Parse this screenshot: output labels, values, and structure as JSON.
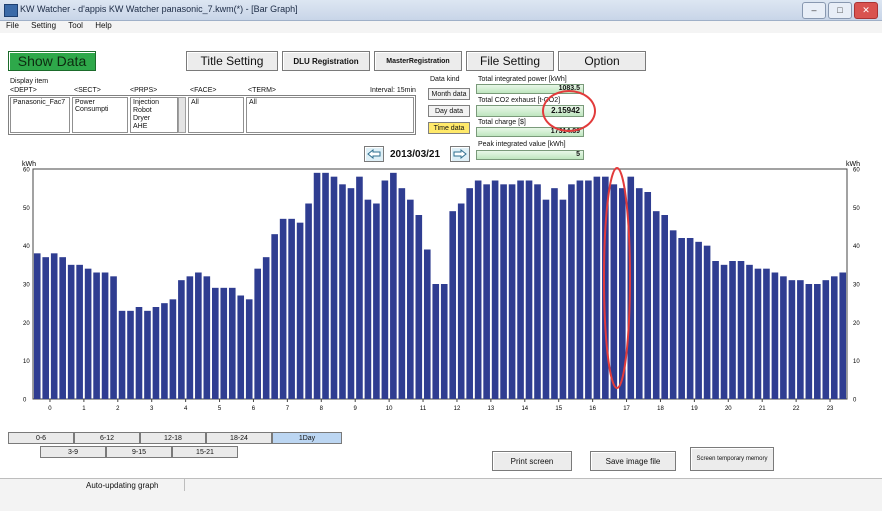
{
  "window": {
    "title": "KW Watcher - d'appis KW Watcher panasonic_7.kwm(*) - [Bar Graph]",
    "controls": [
      "–",
      "□",
      "✕"
    ]
  },
  "menu": [
    "File",
    "Setting",
    "Tool",
    "Help"
  ],
  "toolbar": {
    "show_data": "Show Data",
    "title_setting": "Title Setting",
    "dlu_registration": "DLU Registration",
    "master_registration": "MasterRegistration",
    "file_setting": "File Setting",
    "option": "Option"
  },
  "display_item": {
    "caption": "Display item",
    "dept_label": "<DEPT>",
    "sect_label": "<SECT>",
    "prps_label": "<PRPS>",
    "face_label": "<FACE>",
    "term_label": "<TERM>",
    "interval": "Interval: 15min",
    "dept_value": "Panasonic_Fac7",
    "sect_value": "Power Consumpti",
    "prps_values": [
      "Injection",
      "Robot",
      "Dryer",
      "AHE"
    ],
    "face_value": "All",
    "term_value": "All"
  },
  "data_kind": {
    "caption": "Data kind",
    "month": "Month data",
    "day": "Day data",
    "time": "Time data",
    "selected": "time"
  },
  "totals": {
    "power_label": "Total integrated power [kWh]",
    "power_value": "1083.5",
    "co2_label": "Total CO2 exhaust [t-CO2]",
    "co2_value": "2.15942",
    "charge_label": "Total charge [$]",
    "charge_value": "17314.89",
    "peak_label": "Peak integrated value [kWh]",
    "peak_value": "5"
  },
  "date_nav": {
    "date": "2013/03/21",
    "prev_icon": "arrow-left-icon",
    "next_icon": "arrow-right-icon"
  },
  "chart_data": {
    "type": "bar",
    "ylabel_left": "kWh",
    "ylabel_right": "kWh",
    "ylim": [
      0,
      60
    ],
    "yticks": [
      0,
      10,
      20,
      30,
      40,
      50,
      60
    ],
    "x_tick_labels": [
      "0",
      "1",
      "2",
      "3",
      "4",
      "5",
      "6",
      "7",
      "8",
      "9",
      "10",
      "11",
      "12",
      "13",
      "14",
      "15",
      "16",
      "17",
      "18",
      "19",
      "20",
      "21",
      "22",
      "23"
    ],
    "bar_color": "#2f3d91",
    "grid": false,
    "values": [
      38,
      37,
      38,
      37,
      35,
      35,
      34,
      33,
      33,
      32,
      23,
      23,
      24,
      23,
      24,
      25,
      26,
      31,
      32,
      33,
      32,
      29,
      29,
      29,
      27,
      26,
      34,
      37,
      43,
      47,
      47,
      46,
      51,
      59,
      59,
      58,
      56,
      55,
      58,
      52,
      51,
      57,
      59,
      55,
      52,
      48,
      39,
      30,
      30,
      49,
      51,
      55,
      57,
      56,
      57,
      56,
      56,
      57,
      57,
      56,
      52,
      55,
      52,
      56,
      57,
      57,
      58,
      58,
      56,
      55,
      58,
      55,
      54,
      49,
      48,
      44,
      42,
      42,
      41,
      40,
      36,
      35,
      36,
      36,
      35,
      34,
      34,
      33,
      32,
      31,
      31,
      30,
      30,
      31,
      32,
      33
    ]
  },
  "range_tabs_row1": [
    "0-6",
    "6-12",
    "12-18",
    "18-24",
    "1Day"
  ],
  "range_tabs_row2": [
    "3-9",
    "9-15",
    "15-21"
  ],
  "range_tabs_active": "1Day",
  "actions": {
    "print": "Print screen",
    "save_image": "Save image file",
    "temp_memory": "Screen temporary memory"
  },
  "status": {
    "text": "Auto-updating graph"
  }
}
